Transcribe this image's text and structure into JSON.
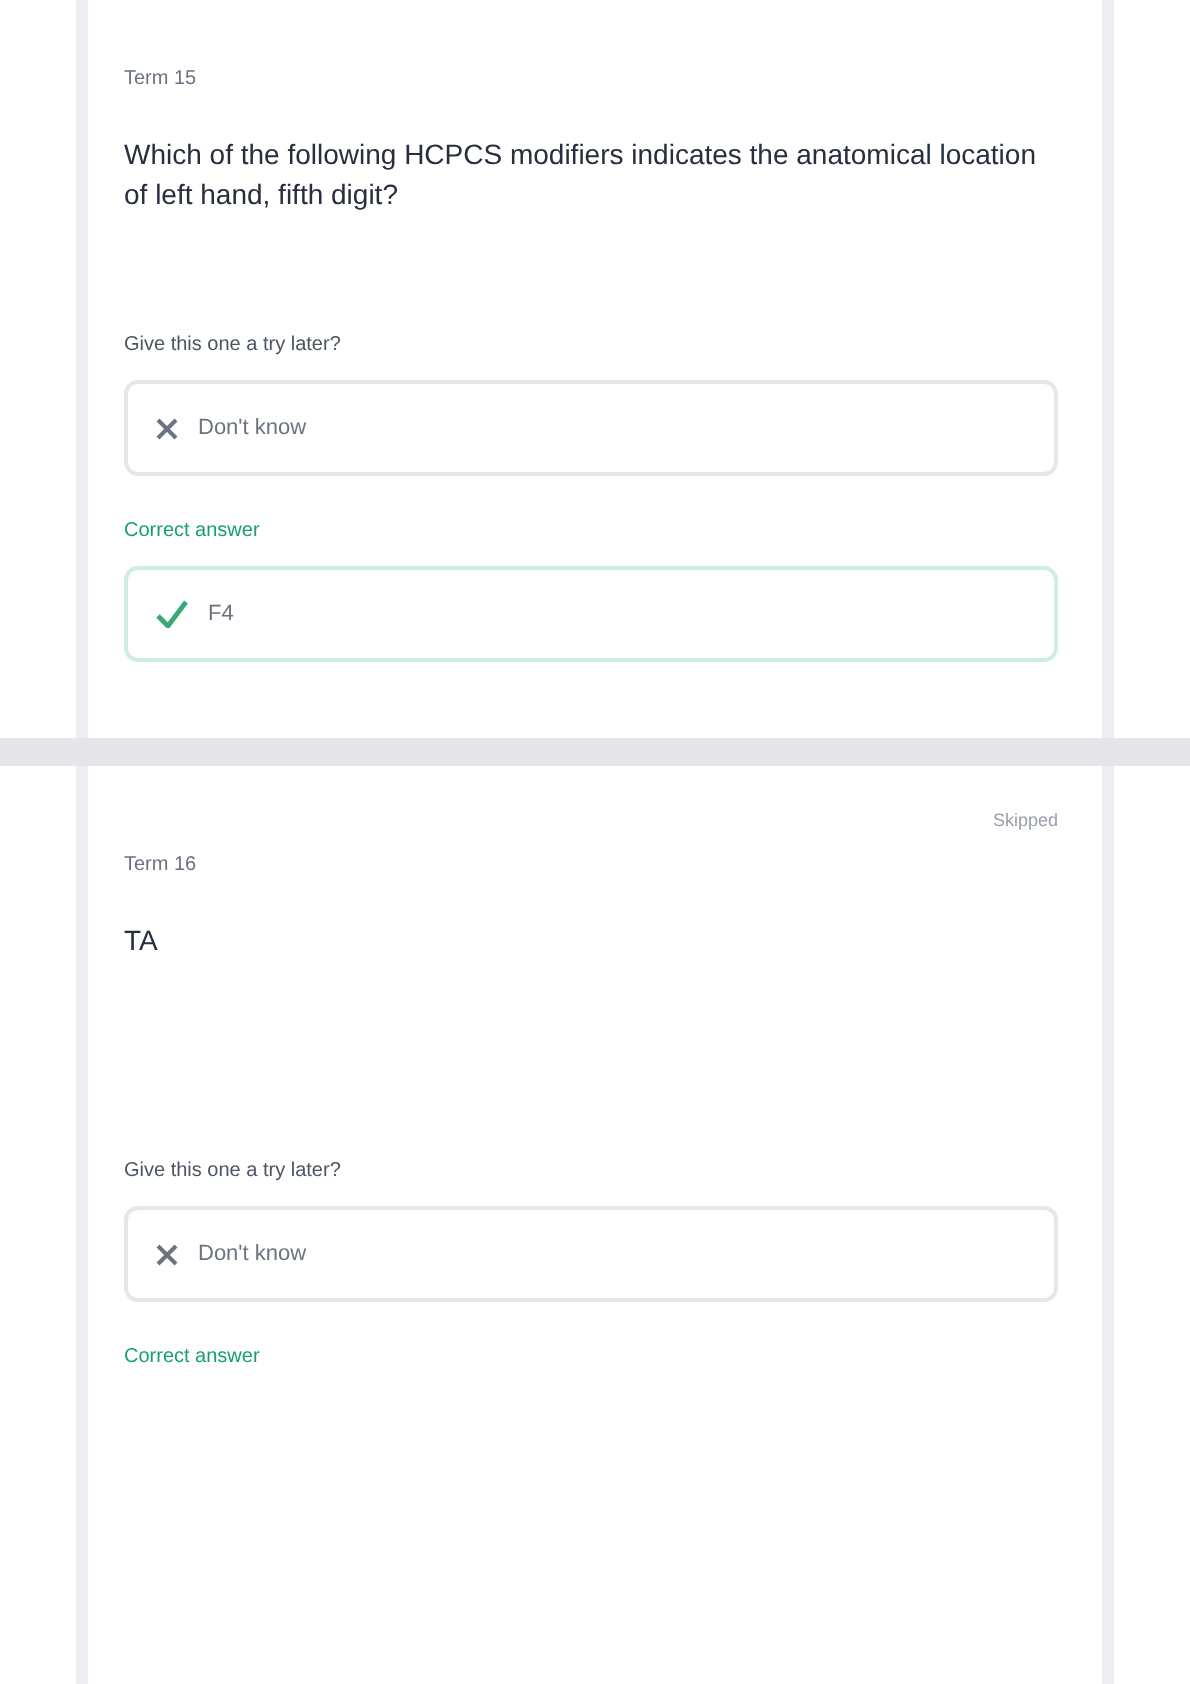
{
  "cards": [
    {
      "label": "Term 15",
      "question": "Which of the following HCPCS modifiers indicates the anatomical location of left hand, fifth digit?",
      "prompt": "Give this one a try later?",
      "answer": {
        "kind": "unknown",
        "text": "Don't know"
      },
      "correct_label": "Correct answer",
      "correct": {
        "kind": "correct",
        "text": "F4"
      }
    },
    {
      "status": "Skipped",
      "label": "Term 16",
      "question": "TA",
      "prompt": "Give this one a try later?",
      "answer": {
        "kind": "unknown",
        "text": "Don't know"
      },
      "correct_label": "Correct answer"
    }
  ]
}
